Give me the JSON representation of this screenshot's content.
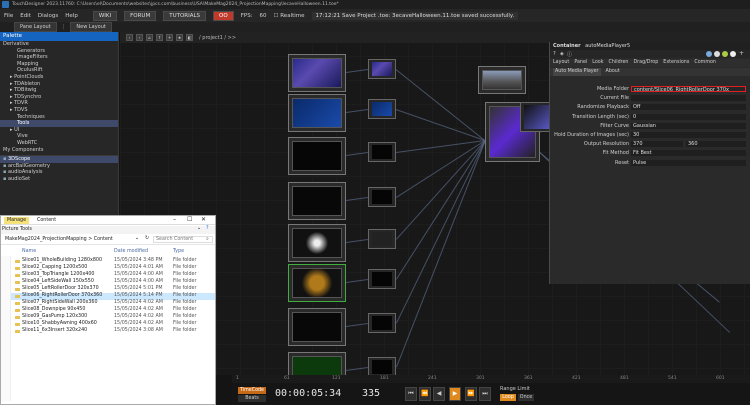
{
  "window": {
    "title": "TouchDesigner 2023.11760: C:\\Users\\el\\Documents\\websites\\jpcs.com\\business\\USA\\MakeMag2024_ProjectionMapping\\lecaveHalloween.11.toe*"
  },
  "menubar": {
    "items": [
      "File",
      "Edit",
      "Dialogs",
      "Help"
    ],
    "wiki": "WIKI",
    "forum": "FORUM",
    "tutorials": "TUTORIALS",
    "oo": "OO",
    "fps_label": "FPS:",
    "fps_value": "60",
    "realtime": "Realtime",
    "message": "17:12:21 Save Project .toe: 3ecaveHalloween.11.toe saved successfully."
  },
  "pane_tabs": [
    "Pane Layout",
    "New Layout"
  ],
  "network": {
    "path": "/ project1 / >>"
  },
  "palette": {
    "title": "Palette",
    "items": [
      {
        "label": "Derivative",
        "indent": 0,
        "selected": false
      },
      {
        "label": "Generators",
        "indent": 2,
        "selected": false
      },
      {
        "label": "ImageFilters",
        "indent": 2,
        "selected": false
      },
      {
        "label": "Mapping",
        "indent": 2,
        "selected": false
      },
      {
        "label": "OculusRift",
        "indent": 2,
        "selected": false
      },
      {
        "label": "PointClouds",
        "indent": 1,
        "selected": false
      },
      {
        "label": "TDAbleton",
        "indent": 1,
        "selected": false
      },
      {
        "label": "TDBitwig",
        "indent": 1,
        "selected": false
      },
      {
        "label": "TDSynchro",
        "indent": 1,
        "selected": false
      },
      {
        "label": "TDVR",
        "indent": 1,
        "selected": false
      },
      {
        "label": "TDVS",
        "indent": 1,
        "selected": false
      },
      {
        "label": "Techniques",
        "indent": 2,
        "selected": false
      },
      {
        "label": "Tools",
        "indent": 2,
        "selected": true
      },
      {
        "label": "UI",
        "indent": 1,
        "selected": false
      },
      {
        "label": "Vive",
        "indent": 2,
        "selected": false
      },
      {
        "label": "WebRTC",
        "indent": 2,
        "selected": false
      },
      {
        "label": "My Components",
        "indent": 0,
        "selected": false
      }
    ],
    "lower_items": [
      {
        "label": "3DScope",
        "selected": true
      },
      {
        "label": "arcBallGeometry",
        "selected": false
      },
      {
        "label": "audioAnalysis",
        "selected": false
      },
      {
        "label": "audioSet",
        "selected": false
      }
    ]
  },
  "param": {
    "container_type": "Container",
    "node_name": "autoMediaPlayer5",
    "tabs": [
      "Layout",
      "Panel",
      "Look",
      "Children",
      "Drag/Drop",
      "Extensions",
      "Common"
    ],
    "sub_tabs": [
      "Auto Media Player",
      "About"
    ],
    "rows": [
      {
        "label": "Media Folder",
        "value": "content/Slice06_RightRollerDoor 370x",
        "highlight": true
      },
      {
        "label": "Current File",
        "value": "",
        "highlight": false
      },
      {
        "label": "Randomize Playback",
        "value": "Off",
        "highlight": false
      },
      {
        "label": "Transition Length (sec)",
        "value": "0",
        "highlight": false
      },
      {
        "label": "Filter Curve",
        "value": "Gaussian",
        "highlight": false
      },
      {
        "label": "Hold Duration of Images (sec)",
        "value": "30",
        "highlight": false
      },
      {
        "label": "Output Resolution",
        "value": "370",
        "value2": "360",
        "highlight": false
      },
      {
        "label": "Fit Method",
        "value": "Fit Best",
        "highlight": false
      },
      {
        "label": "Reset",
        "value": "Pulse",
        "highlight": false
      }
    ]
  },
  "explorer": {
    "ribbon_tabs": [
      "Manage",
      "Content"
    ],
    "ribbon_sub": "Picture Tools",
    "path": "MakeMag2024_ProjectionMapping  >  Content",
    "search_placeholder": "Search Content",
    "columns": [
      "Name",
      "Date modified",
      "Type"
    ],
    "rows": [
      {
        "name": "Slice01_WholeBuilding 1280x800",
        "date": "15/05/2024 3:48 PM",
        "type": "File folder",
        "selected": false
      },
      {
        "name": "Slice02_Capping 1200x500",
        "date": "15/05/2024 4:01 AM",
        "type": "File folder",
        "selected": false
      },
      {
        "name": "Slice03_TopTriangle 1200x400",
        "date": "15/05/2024 4:00 AM",
        "type": "File folder",
        "selected": false
      },
      {
        "name": "Slice04_LeftSideWall 150x550",
        "date": "15/05/2024 4:00 AM",
        "type": "File folder",
        "selected": false
      },
      {
        "name": "Slice05_LeftRollerDoor 320x370",
        "date": "15/05/2024 5:01 PM",
        "type": "File folder",
        "selected": false
      },
      {
        "name": "Slice06_RightRollerDoor 370x360",
        "date": "15/05/2024 5:14 PM",
        "type": "File folder",
        "selected": true
      },
      {
        "name": "Slice07_RightSideWall 200x360",
        "date": "15/05/2024 4:02 AM",
        "type": "File folder",
        "selected": false
      },
      {
        "name": "Slice08_Downpipe 90x450",
        "date": "15/05/2024 4:02 AM",
        "type": "File folder",
        "selected": false
      },
      {
        "name": "Slice09_GasPump 120x300",
        "date": "15/05/2024 4:02 AM",
        "type": "File folder",
        "selected": false
      },
      {
        "name": "Slice10_ShabbyAwning 400x60",
        "date": "15/05/2024 4:02 AM",
        "type": "File folder",
        "selected": false
      },
      {
        "name": "Slice11_6x3Insert 320x240",
        "date": "15/05/2024 3:08 AM",
        "type": "File folder",
        "selected": false
      }
    ]
  },
  "timeline": {
    "timecode_label": "TimeCode",
    "beats_label": "Beats",
    "timecode": "00:00:05:34",
    "frame": "335",
    "range_label": "Range Limit",
    "loop": "Loop",
    "once": "Once",
    "ticks": [
      "1",
      "61",
      "121",
      "181",
      "241",
      "301",
      "361",
      "421",
      "481",
      "541",
      "601"
    ]
  }
}
